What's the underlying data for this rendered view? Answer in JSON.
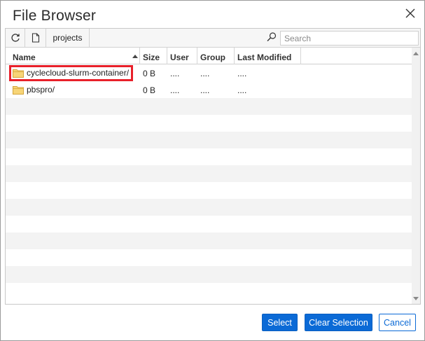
{
  "dialog": {
    "title": "File Browser",
    "close_icon": "close-icon"
  },
  "toolbar": {
    "refresh_icon": "refresh-icon",
    "new_file_icon": "new-file-icon",
    "path_label": "projects",
    "search_icon": "search-icon",
    "search_placeholder": "Search"
  },
  "table": {
    "columns": [
      "Name",
      "Size",
      "User",
      "Group",
      "Last Modified"
    ],
    "sort_column": "Name",
    "sort_direction": "ascending",
    "rows": [
      {
        "name": "cyclecloud-slurm-container/",
        "size": "0 B",
        "user": "....",
        "group": "....",
        "modified": "....",
        "type": "folder",
        "highlighted": true
      },
      {
        "name": "pbspro/",
        "size": "0 B",
        "user": "....",
        "group": "....",
        "modified": "....",
        "type": "folder",
        "highlighted": false
      }
    ]
  },
  "buttons": {
    "select": "Select",
    "clear_selection": "Clear Selection",
    "cancel": "Cancel"
  },
  "colors": {
    "primary": "#0b6ad6",
    "highlight_border": "#e8202a",
    "folder": "#f4c64e"
  }
}
